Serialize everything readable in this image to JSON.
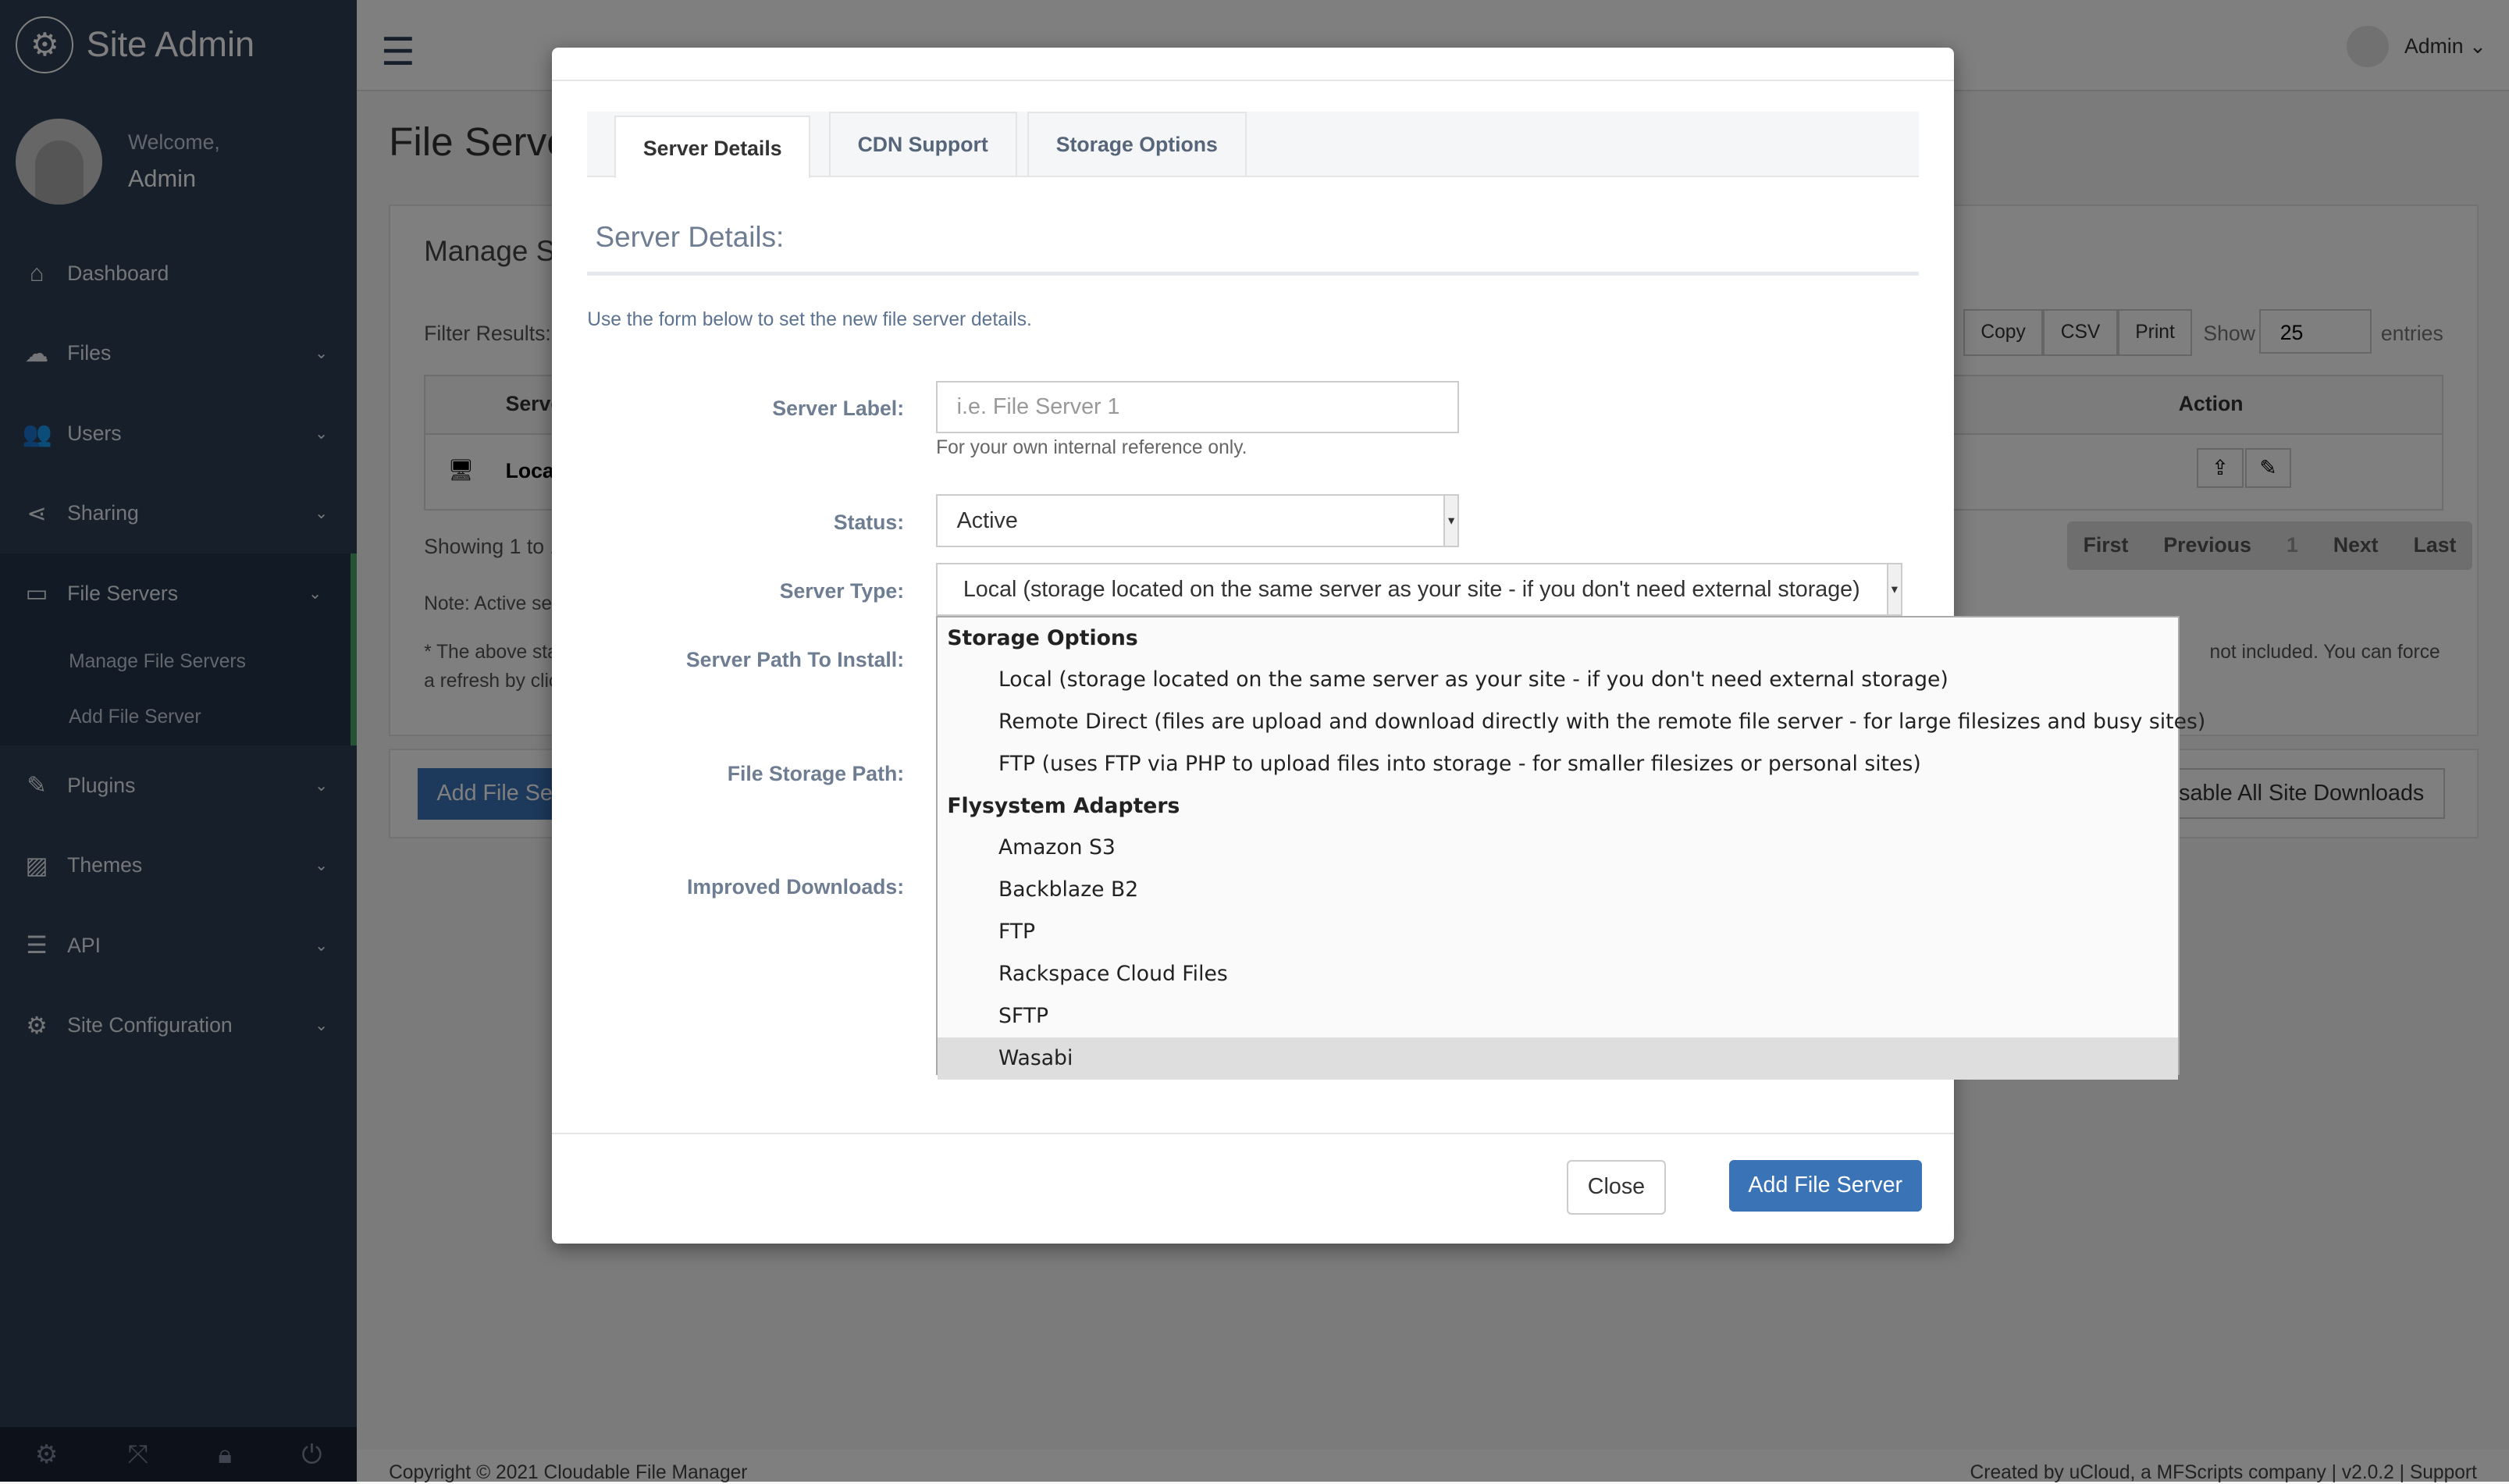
{
  "brand": {
    "title": "Site Admin",
    "icon": "gears-icon"
  },
  "profile": {
    "welcome": "Welcome,",
    "name": "Admin"
  },
  "sidebar": {
    "items": [
      {
        "label": "Dashboard",
        "icon": "home-icon"
      },
      {
        "label": "Files",
        "icon": "cloud-upload-icon"
      },
      {
        "label": "Users",
        "icon": "users-icon"
      },
      {
        "label": "Sharing",
        "icon": "share-icon"
      },
      {
        "label": "File Servers",
        "icon": "server-icon"
      },
      {
        "label": "Plugins",
        "icon": "plug-icon"
      },
      {
        "label": "Themes",
        "icon": "image-icon"
      },
      {
        "label": "API",
        "icon": "database-icon"
      },
      {
        "label": "Site Configuration",
        "icon": "gear-icon"
      }
    ],
    "subitems": [
      "Manage File Servers",
      "Add File Server"
    ]
  },
  "topbar": {
    "user": "Admin"
  },
  "page": {
    "title": "File Servers",
    "panel_title": "Manage Servers",
    "filter_label": "Filter Results:",
    "buttons": [
      "Copy",
      "CSV",
      "Print"
    ],
    "show": "Show",
    "entries_value": "25",
    "entries": "entries",
    "col_server": "Server",
    "col_action": "Action",
    "row_label": "Local",
    "showing": "Showing 1 to 1",
    "pager": [
      "First",
      "Previous",
      "1",
      "Next",
      "Last"
    ],
    "note": "Note: Active servers",
    "note2_start": "* The above stats",
    "note2_end": "not included. You can force",
    "note2_line2": "a refresh by clicking",
    "add_button": "Add File Server",
    "disable_button": "Disable All Site Downloads"
  },
  "footer": {
    "copyright": "Copyright © 2021 Cloudable File Manager",
    "credits": "Created by uCloud, a MFScripts company | v2.0.2 | Support"
  },
  "modal": {
    "tabs": [
      "Server Details",
      "CDN Support",
      "Storage Options"
    ],
    "section_title": "Server Details:",
    "intro": "Use the form below to set the new file server details.",
    "fields": {
      "server_label": {
        "label": "Server Label:",
        "placeholder": "i.e. File Server 1",
        "hint": "For your own internal reference only."
      },
      "status": {
        "label": "Status:",
        "value": "Active"
      },
      "server_type": {
        "label": "Server Type:",
        "value": "Local (storage located on the same server as your site - if you don't need external storage)"
      },
      "server_path": {
        "label": "Server Path To Install:"
      },
      "file_storage_path": {
        "label": "File Storage Path:"
      },
      "improved_downloads": {
        "label": "Improved Downloads:"
      }
    },
    "close": "Close",
    "submit": "Add File Server"
  },
  "dropdown": {
    "groups": [
      {
        "label": "Storage Options",
        "options": [
          "Local (storage located on the same server as your site - if you don't need external storage)",
          "Remote Direct (files are upload and download directly with the remote file server - for large filesizes and busy sites)",
          "FTP (uses FTP via PHP to upload files into storage - for smaller filesizes or personal sites)"
        ]
      },
      {
        "label": "Flysystem Adapters",
        "options": [
          "Amazon S3",
          "Backblaze B2",
          "FTP",
          "Rackspace Cloud Files",
          "SFTP",
          "Wasabi"
        ]
      }
    ],
    "highlighted": "Wasabi"
  },
  "colors": {
    "sidebar": "#2f3f56",
    "primary": "#3a73b6",
    "active_border": "#4aa66b"
  }
}
